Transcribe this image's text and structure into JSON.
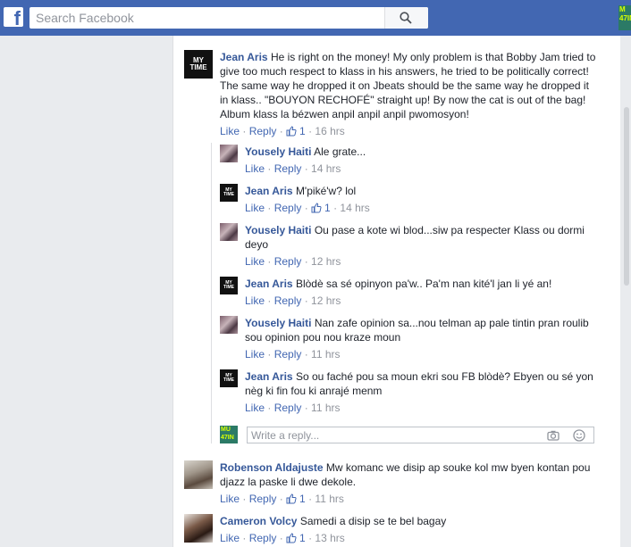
{
  "header": {
    "logo": "f",
    "search_placeholder": "Search Facebook",
    "corner_thumb": "M\n47IN"
  },
  "actions": {
    "like": "Like",
    "reply": "Reply",
    "sep": " · "
  },
  "comments": [
    {
      "name": "Jean Aris",
      "text": "He is right on the money! My only problem is that Bobby Jam tried to give too much respect to klass in his answers, he tried to be politically correct! The same way he dropped it on Jbeats should be the same way he dropped it in klass.. \"BOUYON RECHOFÉ\" straight up! By now the cat is out of the bag! Album klass la bézwen anpil anpil anpil pwomosyon!",
      "likes": "1",
      "time": "16 hrs",
      "avatar_text": [
        "MY",
        "TIME"
      ]
    }
  ],
  "replies": [
    {
      "name": "Yousely Haiti",
      "text": "Ale grate...",
      "time": "14 hrs"
    },
    {
      "name": "Jean Aris",
      "text": "M'piké'w? lol",
      "likes": "1",
      "time": "14 hrs"
    },
    {
      "name": "Yousely Haiti",
      "text": "Ou pase a kote wi blod...siw pa respecter Klass ou dormi deyo",
      "time": "12 hrs"
    },
    {
      "name": "Jean Aris",
      "text": "Blòdè sa sé opinyon pa'w.. Pa'm nan kité'l jan li yé an!",
      "time": "12 hrs"
    },
    {
      "name": "Yousely Haiti",
      "text": "Nan zafe opinion sa...nou telman ap pale tintin pran roulib sou opinion pou nou kraze moun",
      "time": "11 hrs"
    },
    {
      "name": "Jean Aris",
      "text": "So ou faché pou sa moun ekri sou FB blòdè? Ebyen ou sé yon nèg ki fin fou ki anrajé menm",
      "time": "11 hrs"
    }
  ],
  "reply_box": {
    "placeholder": "Write a reply...",
    "avatar_text": "MU\n47IN"
  },
  "bottom_comments": [
    {
      "name": "Robenson Aldajuste",
      "text": "Mw komanc we disip ap souke kol mw byen kontan pou djazz la paske li dwe dekole.",
      "likes": "1",
      "time": "11 hrs"
    },
    {
      "name": "Cameron Volcy",
      "text": "Samedi a disip se te bel bagay",
      "likes": "1",
      "time": "13 hrs"
    }
  ],
  "colors": {
    "topbar": "#4267b2",
    "name": "#365899",
    "link": "#4267b2",
    "meta": "#90949c",
    "background": "#e9ebee"
  }
}
